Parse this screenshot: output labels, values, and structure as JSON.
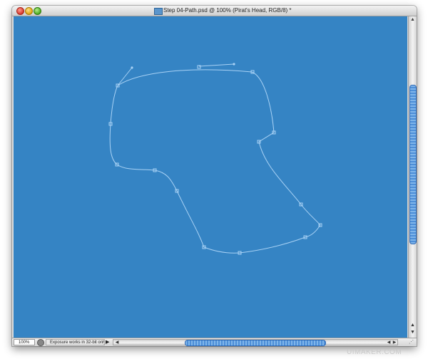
{
  "window": {
    "title": "Step 04-Path.psd @ 100% (Pirat's Head, RGB/8) *",
    "canvas_color": "#3584c4",
    "path_color": "#a9d2f5"
  },
  "statusbar": {
    "zoom": "100%",
    "message": "Exposure works in 32-bit only",
    "arrow_glyph": "▶"
  },
  "scrollbars": {
    "up_glyph": "▲",
    "down_glyph": "▼",
    "left_glyph": "◀",
    "right_glyph": "▶"
  },
  "watermark": {
    "text": "UIMAKER.COM"
  },
  "icons": {
    "close": "close-icon",
    "minimize": "minimize-icon",
    "zoom": "zoom-icon",
    "document": "document-icon",
    "info": "info-icon",
    "grip": "resize-grip-icon"
  }
}
